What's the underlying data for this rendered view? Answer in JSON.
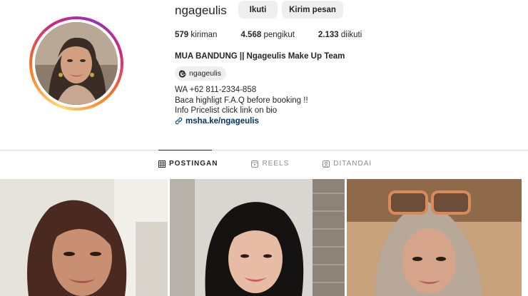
{
  "profile": {
    "username": "ngageulis",
    "follow_label": "Ikuti",
    "message_label": "Kirim pesan",
    "stats": {
      "posts_count": "579",
      "posts_label": "kiriman",
      "followers_count": "4.568",
      "followers_label": "pengikut",
      "following_count": "2.133",
      "following_label": "diikuti"
    },
    "full_name": "MUA BANDUNG || Ngageulis Make Up Team",
    "threads_handle": "ngageulis",
    "bio_lines": [
      "WA +62 811-2334-858",
      "Baca highligt F.A.Q before booking !!",
      "Info Pricelist click link on bio"
    ],
    "link": "msha.ke/ngageulis"
  },
  "tabs": [
    {
      "label": "POSTINGAN",
      "icon": "grid-icon",
      "active": true
    },
    {
      "label": "REELS",
      "icon": "reels-icon",
      "active": false
    },
    {
      "label": "DITANDAI",
      "icon": "tagged-icon",
      "active": false
    }
  ],
  "colors": {
    "link": "#00376b",
    "button_bg": "#efefef",
    "divider": "#dbdbdb"
  }
}
